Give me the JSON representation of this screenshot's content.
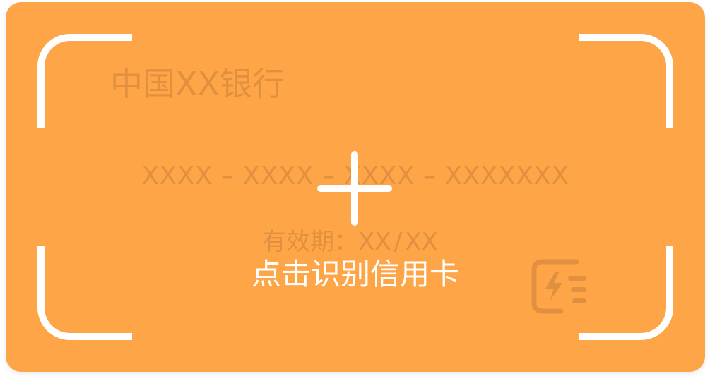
{
  "card": {
    "background_color": "#fea548",
    "placeholder_color": "#d68a3c",
    "bank_name": "中国XX银行",
    "card_number": "XXXX – XXXX – XXXX – XXXXXXX",
    "expiry_label": "有效期：",
    "expiry_month": "XX",
    "expiry_separator": "/",
    "expiry_year": "XX",
    "chip_icon": "card-lightning-icon"
  },
  "scan": {
    "plus_icon": "plus-icon",
    "label": "点击识别信用卡"
  }
}
